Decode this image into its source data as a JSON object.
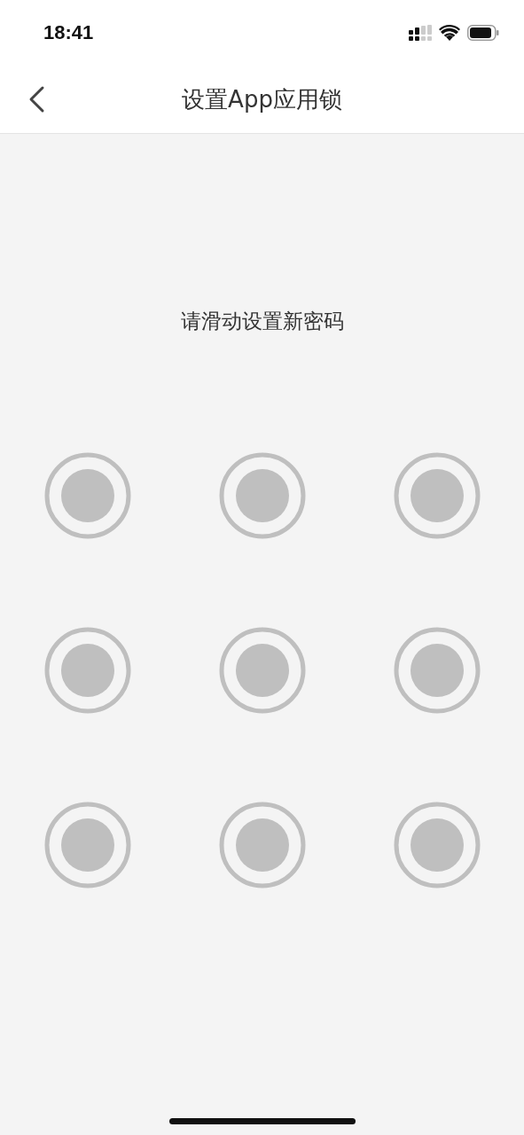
{
  "status_bar": {
    "time": "18:41"
  },
  "header": {
    "title": "设置App应用锁"
  },
  "prompt": "请滑动设置新密码",
  "pattern_nodes": [
    {
      "selected": false
    },
    {
      "selected": false
    },
    {
      "selected": false
    },
    {
      "selected": false
    },
    {
      "selected": false
    },
    {
      "selected": false
    },
    {
      "selected": false
    },
    {
      "selected": false
    },
    {
      "selected": false
    }
  ]
}
